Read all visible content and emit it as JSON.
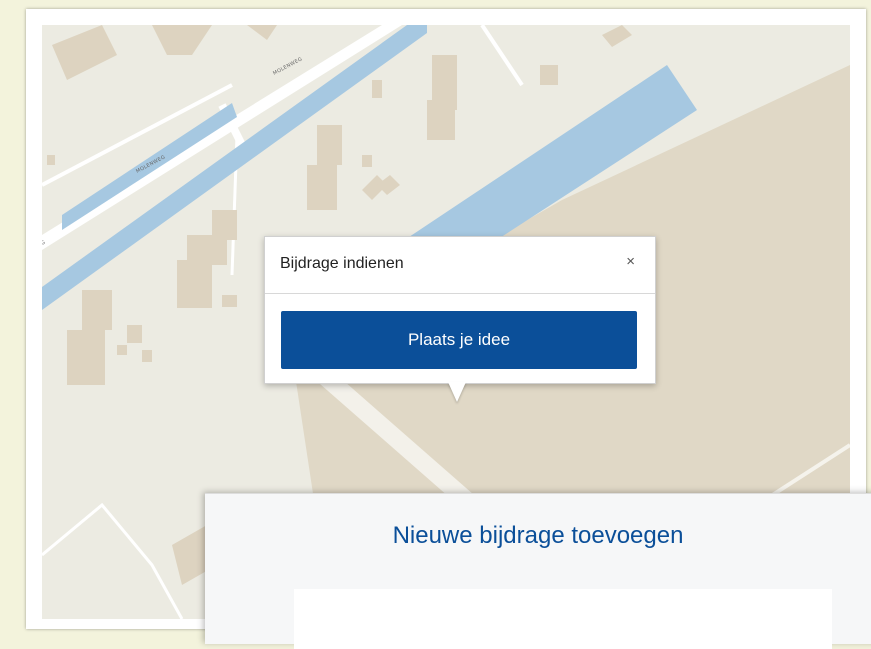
{
  "map": {
    "road_labels": [
      "MOLENWEG",
      "MOLENWEG",
      "G"
    ],
    "colors": {
      "land": "#ecebe2",
      "water": "#a6c8e1",
      "building": "#ddd3c0",
      "field": "#e0d8c6",
      "road": "#ffffff"
    }
  },
  "popup": {
    "title": "Bijdrage indienen",
    "close_glyph": "×",
    "button_label": "Plaats je idee"
  },
  "panel": {
    "title": "Nieuwe bijdrage toevoegen"
  },
  "colors": {
    "accent": "#0b4f99",
    "page_background": "#f3f3dc"
  }
}
